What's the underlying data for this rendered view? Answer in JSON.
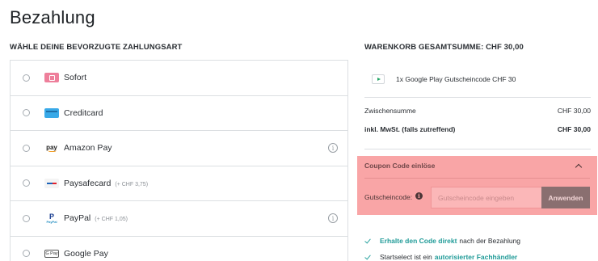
{
  "page": {
    "title": "Bezahlung"
  },
  "payment": {
    "heading": "WÄHLE DEINE BEVORZUGTE ZAHLUNGSART",
    "methods": [
      {
        "label": "Sofort",
        "fee": "",
        "icon": "sofort-logo-icon",
        "info": false
      },
      {
        "label": "Creditcard",
        "fee": "",
        "icon": "creditcard-logo-icon",
        "info": false
      },
      {
        "label": "Amazon Pay",
        "fee": "",
        "icon": "amazon-pay-logo-icon",
        "info": true
      },
      {
        "label": "Paysafecard",
        "fee": "(+ CHF 3,75)",
        "icon": "paysafecard-logo-icon",
        "info": false
      },
      {
        "label": "PayPal",
        "fee": "(+ CHF 1,05)",
        "icon": "paypal-logo-icon",
        "info": true
      },
      {
        "label": "Google Pay",
        "fee": "",
        "icon": "google-pay-logo-icon",
        "info": false
      }
    ],
    "logo_text": {
      "amazon": "pay",
      "paypal": "P",
      "paypal_word": "PayPal",
      "gpay": "G Pay"
    }
  },
  "cart": {
    "heading": "WARENKORB GESAMTSUMME: CHF 30,00",
    "item": "1x Google Play Gutscheincode CHF 30",
    "subtotal_label": "Zwischensumme",
    "subtotal_value": "CHF 30,00",
    "total_label": "inkl. MwSt. (falls zutreffend)",
    "total_value": "CHF 30,00"
  },
  "coupon": {
    "title": "Coupon Code einlöse",
    "label": "Gutscheincode:",
    "info_glyph": "i",
    "placeholder": "Gutscheincode eingeben",
    "apply_label": "Anwenden"
  },
  "benefits": [
    {
      "highlight": "Erhalte den Code direkt",
      "text": "nach der Bezahlung"
    },
    {
      "text": "Startselect ist ein",
      "highlight": "autorisierter Fachhändler"
    }
  ],
  "colors": {
    "accent": "#209b98",
    "coupon_bg": "#f9a5a6",
    "apply_button": "#8a6f70"
  }
}
